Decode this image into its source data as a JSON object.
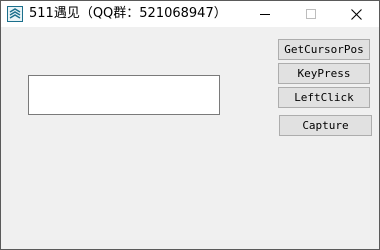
{
  "window": {
    "title": "511遇见（QQ群：521068947）"
  },
  "buttons": {
    "get_cursor_pos": "GetCursorPos",
    "key_press": "KeyPress",
    "left_click": "LeftClick",
    "capture": "Capture"
  },
  "input": {
    "value": ""
  },
  "icons": {
    "app": "app-icon",
    "minimize": "minimize-icon",
    "maximize": "maximize-icon",
    "close": "close-icon"
  },
  "colors": {
    "client_background": "#f0f0f0",
    "button_face": "#e1e1e1",
    "button_border": "#adadad",
    "app_icon": "#1b6f8c"
  }
}
